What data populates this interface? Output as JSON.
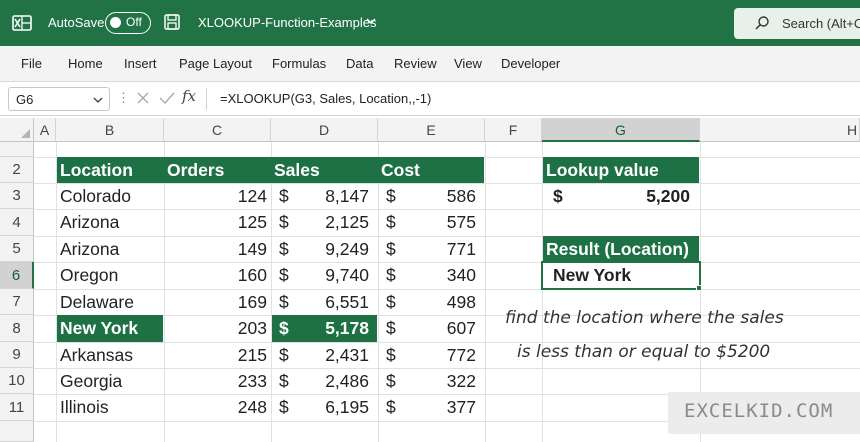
{
  "titlebar": {
    "autosave_label": "AutoSave",
    "autosave_state": "Off",
    "document_title": "XLOOKUP-Function-Examples",
    "search_text": "Search (Alt+C"
  },
  "ribbon": {
    "tabs": [
      "File",
      "Home",
      "Insert",
      "Page Layout",
      "Formulas",
      "Data",
      "Review",
      "View",
      "Developer"
    ]
  },
  "formula_bar": {
    "name_box": "G6",
    "dots": "⋮",
    "fx": "fx",
    "formula": "=XLOOKUP(G3, Sales, Location,,-1)"
  },
  "grid": {
    "columns": [
      "A",
      "B",
      "C",
      "D",
      "E",
      "F",
      "G",
      "H"
    ],
    "rows": [
      "2",
      "3",
      "4",
      "5",
      "6",
      "7",
      "8",
      "9",
      "10",
      "11"
    ],
    "selected_column": "G",
    "selected_row": "6",
    "table_headers": {
      "location": "Location",
      "orders": "Orders",
      "sales": "Sales",
      "cost": "Cost"
    },
    "data_rows": [
      {
        "location": "Colorado",
        "orders": "124",
        "sales_cur": "$",
        "sales": "8,147",
        "cost_cur": "$",
        "cost": "586"
      },
      {
        "location": "Arizona",
        "orders": "125",
        "sales_cur": "$",
        "sales": "2,125",
        "cost_cur": "$",
        "cost": "575"
      },
      {
        "location": "Arizona",
        "orders": "149",
        "sales_cur": "$",
        "sales": "9,249",
        "cost_cur": "$",
        "cost": "771"
      },
      {
        "location": "Oregon",
        "orders": "160",
        "sales_cur": "$",
        "sales": "9,740",
        "cost_cur": "$",
        "cost": "340"
      },
      {
        "location": "Delaware",
        "orders": "169",
        "sales_cur": "$",
        "sales": "6,551",
        "cost_cur": "$",
        "cost": "498"
      },
      {
        "location": "New York",
        "orders": "203",
        "sales_cur": "$",
        "sales": "5,178",
        "cost_cur": "$",
        "cost": "607"
      },
      {
        "location": "Arkansas",
        "orders": "215",
        "sales_cur": "$",
        "sales": "2,431",
        "cost_cur": "$",
        "cost": "772"
      },
      {
        "location": "Georgia",
        "orders": "233",
        "sales_cur": "$",
        "sales": "2,486",
        "cost_cur": "$",
        "cost": "322"
      },
      {
        "location": "Illinois",
        "orders": "248",
        "sales_cur": "$",
        "sales": "6,195",
        "cost_cur": "$",
        "cost": "377"
      }
    ],
    "lookup": {
      "header": "Lookup value",
      "currency": "$",
      "value": "5,200"
    },
    "result": {
      "header": "Result (Location)",
      "value": "New York"
    }
  },
  "annotation": {
    "line1": "find the location where the sales",
    "line2": "is less than or equal to $5200"
  },
  "watermark": "EXCELKID.COM",
  "colors": {
    "excel_green": "#217346",
    "table_header": "#1e7145"
  }
}
